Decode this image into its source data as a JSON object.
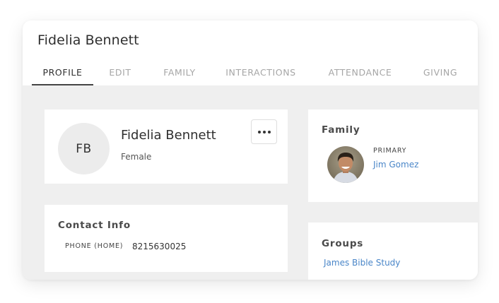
{
  "header": {
    "title": "Fidelia Bennett"
  },
  "tabs": [
    {
      "label": "PROFILE"
    },
    {
      "label": "EDIT"
    },
    {
      "label": "FAMILY"
    },
    {
      "label": "INTERACTIONS"
    },
    {
      "label": "ATTENDANCE"
    },
    {
      "label": "GIVING"
    }
  ],
  "active_tab": "PROFILE",
  "profile": {
    "initials": "FB",
    "name": "Fidelia Bennett",
    "gender": "Female",
    "more_icon": "more-horizontal-icon"
  },
  "contact": {
    "heading": "Contact Info",
    "phone_label": "PHONE (HOME)",
    "phone_value": "8215630025"
  },
  "family": {
    "heading": "Family",
    "members": [
      {
        "role": "PRIMARY",
        "name": "Jim Gomez"
      }
    ]
  },
  "groups": {
    "heading": "Groups",
    "items": [
      "James Bible Study"
    ]
  },
  "colors": {
    "link": "#4a86c8",
    "content_bg": "#efefef",
    "active_tab_underline": "#444444"
  }
}
